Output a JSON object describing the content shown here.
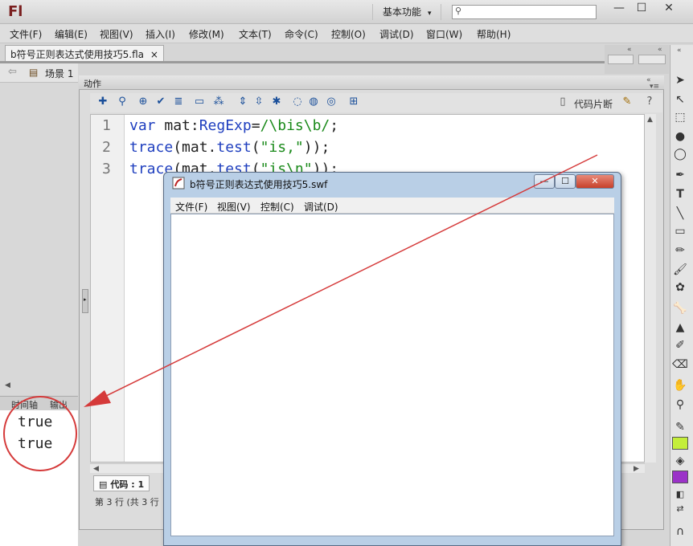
{
  "app": {
    "logo": "Fl",
    "workspace": "基本功能",
    "window_buttons": [
      "—",
      "☐",
      "✕"
    ]
  },
  "menu": [
    "文件(F)",
    "编辑(E)",
    "视图(V)",
    "插入(I)",
    "修改(M)",
    "文本(T)",
    "命令(C)",
    "控制(O)",
    "调试(D)",
    "窗口(W)",
    "帮助(H)"
  ],
  "document": {
    "tab_label": "b符号正则表达式使用技巧5.fla",
    "tab_close": "×",
    "scene_label": "场景 1"
  },
  "output_panel": {
    "tabs": [
      "时间轴",
      "输出"
    ],
    "lines": [
      "true",
      "true"
    ]
  },
  "actions_panel": {
    "title": "动作",
    "snippets_label": "代码片断",
    "code": [
      {
        "num": "1",
        "parts": [
          {
            "t": "var",
            "c": "kw"
          },
          {
            "t": " mat:",
            "c": "pl"
          },
          {
            "t": "RegExp",
            "c": "kw"
          },
          {
            "t": "=",
            "c": "pl"
          },
          {
            "t": "/\\bis\\b/",
            "c": "str"
          },
          {
            "t": ";",
            "c": "pl"
          }
        ]
      },
      {
        "num": "2",
        "parts": [
          {
            "t": "trace",
            "c": "kw"
          },
          {
            "t": "(mat.",
            "c": "pl"
          },
          {
            "t": "test",
            "c": "kw"
          },
          {
            "t": "(",
            "c": "pl"
          },
          {
            "t": "\"is,\"",
            "c": "str"
          },
          {
            "t": "));",
            "c": "pl"
          }
        ]
      },
      {
        "num": "3",
        "parts": [
          {
            "t": "trace",
            "c": "kw"
          },
          {
            "t": "(mat.",
            "c": "pl"
          },
          {
            "t": "test",
            "c": "kw"
          },
          {
            "t": "(",
            "c": "pl"
          },
          {
            "t": "\"is\\n\"",
            "c": "str"
          },
          {
            "t": "));",
            "c": "pl"
          }
        ]
      }
    ],
    "code_tab": "代码 : 1",
    "status": "第 3 行 (共 3 行"
  },
  "swf_window": {
    "title": "b符号正则表达式使用技巧5.swf",
    "menu": [
      "文件(F)",
      "视图(V)",
      "控制(C)",
      "调试(D)"
    ],
    "buttons": [
      "—",
      "☐",
      "✕"
    ]
  },
  "colors": {
    "fill_swatch": "#c4ee3a",
    "stroke_swatch": "#9b32c8",
    "annotation": "#d53a3a",
    "keyword": "#1f3fbf",
    "string": "#1a8a1a"
  }
}
